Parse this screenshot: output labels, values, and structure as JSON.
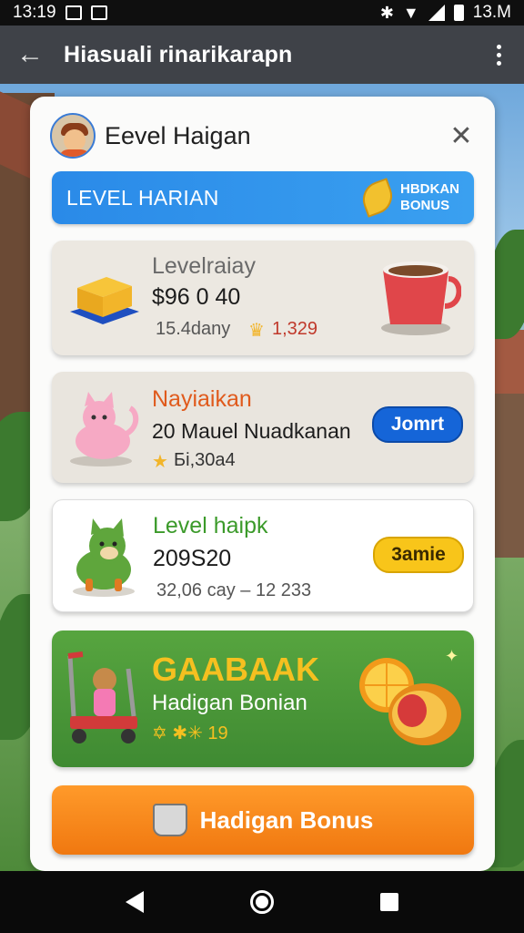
{
  "status_bar": {
    "time": "13:19",
    "right_text": "13.M"
  },
  "app_bar": {
    "title": "Hiasuali rinarikarapn"
  },
  "card": {
    "title": "Eevel Haigan",
    "banner": {
      "label": "LEVEL HARIAN",
      "bonus_line1": "HBDKAN",
      "bonus_line2": "BONUS"
    },
    "rows": [
      {
        "title": "Levelraiay",
        "amount": "$96 0 40",
        "meta_left": "15.4dany",
        "meta_right": "1,329",
        "title_color": "#6a6a6a"
      },
      {
        "title": "Nayiaikan",
        "subtitle": "20 Mauel Nuadkanan",
        "meta": "Бі,30a4",
        "button": "Jomrt",
        "title_color": "#e05a1c"
      },
      {
        "title": "Level haipk",
        "amount": "209S20",
        "meta": "32,06 cay – 12 233",
        "button": "3amie",
        "title_color": "#3b9a2a"
      },
      {
        "title": "GAABAAK",
        "subtitle": "Hadigan Bonian",
        "meta": "✡ ✱✳ 19"
      }
    ],
    "cta": "Hadigan Bonus"
  },
  "icons": {
    "back": "arrow-left-icon",
    "more": "more-vert-icon",
    "close": "close-icon"
  },
  "colors": {
    "banner": "#2a8ae8",
    "cta": "#f07810",
    "green_card": "#4b9a38",
    "blue_button": "#1565d8",
    "yellow_button": "#f8c51a"
  }
}
